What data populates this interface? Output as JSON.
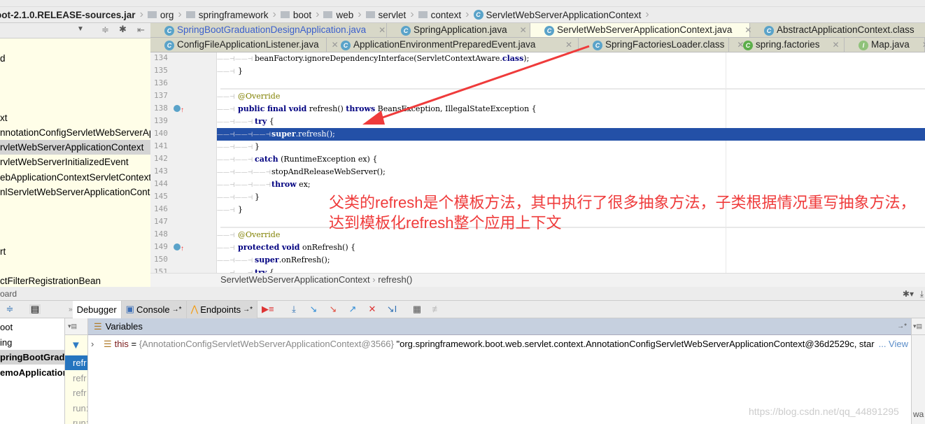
{
  "breadcrumb": [
    "oot-2.1.0.RELEASE-sources.jar",
    "org",
    "springframework",
    "boot",
    "web",
    "servlet",
    "context",
    "ServletWebServerApplicationContext"
  ],
  "project_tree": {
    "items": [
      {
        "label": "d",
        "row": 0
      },
      {
        "label": "xt",
        "row": 4
      },
      {
        "label": "nnotationConfigServletWebServerAppl",
        "row": 5
      },
      {
        "label": "rvletWebServerApplicationContext",
        "row": 6,
        "selected": true
      },
      {
        "label": "rvletWebServerInitializedEvent",
        "row": 7
      },
      {
        "label": "ebApplicationContextServletContextA",
        "row": 8
      },
      {
        "label": "nlServletWebServerApplicationContex",
        "row": 9
      },
      {
        "label": "rt",
        "row": 13
      },
      {
        "label": "ctFilterRegistrationBean",
        "row": 15
      }
    ]
  },
  "tabs_row1": [
    {
      "label": "SpringBootGraduationDesignApplication.java",
      "color": "#3b5fcc"
    },
    {
      "label": "SpringApplication.java"
    },
    {
      "label": "ServletWebServerApplicationContext.java",
      "active": true
    },
    {
      "label": "AbstractApplicationContext.class"
    }
  ],
  "tabs_row2": [
    {
      "label": "ConfigFileApplicationListener.java"
    },
    {
      "label": "ApplicationEnvironmentPreparedEvent.java"
    },
    {
      "label": "SpringFactoriesLoader.class"
    },
    {
      "label": "spring.factories"
    },
    {
      "label": "Map.java"
    }
  ],
  "code": [
    {
      "n": "134",
      "indent": 2,
      "tokens": [
        [
          "beanFactory.ignoreDependencyInterface(ServletContextAware.",
          ""
        ],
        [
          "class",
          "kw"
        ],
        [
          ");",
          ""
        ]
      ]
    },
    {
      "n": "135",
      "indent": 1,
      "tokens": [
        [
          "}",
          ""
        ]
      ]
    },
    {
      "n": "136",
      "indent": 0,
      "tokens": []
    },
    {
      "n": "137",
      "indent": 1,
      "tokens": [
        [
          "@Override",
          "ann"
        ]
      ]
    },
    {
      "n": "138",
      "indent": 1,
      "override": true,
      "tokens": [
        [
          "public",
          "kw"
        ],
        [
          " ",
          ""
        ],
        [
          "final",
          "kw"
        ],
        [
          " ",
          ""
        ],
        [
          "void",
          "kw"
        ],
        [
          " refresh() ",
          ""
        ],
        [
          "throws",
          "kw"
        ],
        [
          " BeansException, IllegalStateException {",
          ""
        ]
      ]
    },
    {
      "n": "139",
      "indent": 2,
      "tokens": [
        [
          "try",
          "kw"
        ],
        [
          " {",
          ""
        ]
      ]
    },
    {
      "n": "140",
      "indent": 3,
      "current": true,
      "tokens": [
        [
          "super",
          "kw"
        ],
        [
          ".refresh();",
          ""
        ]
      ]
    },
    {
      "n": "141",
      "indent": 2,
      "tokens": [
        [
          "}",
          ""
        ]
      ]
    },
    {
      "n": "142",
      "indent": 2,
      "tokens": [
        [
          "catch",
          "kw"
        ],
        [
          " (RuntimeException ex) {",
          ""
        ]
      ]
    },
    {
      "n": "143",
      "indent": 3,
      "tokens": [
        [
          "stopAndReleaseWebServer();",
          ""
        ]
      ]
    },
    {
      "n": "144",
      "indent": 3,
      "tokens": [
        [
          "throw",
          "kw"
        ],
        [
          " ex;",
          ""
        ]
      ]
    },
    {
      "n": "145",
      "indent": 2,
      "tokens": [
        [
          "}",
          ""
        ]
      ]
    },
    {
      "n": "146",
      "indent": 1,
      "tokens": [
        [
          "}",
          ""
        ]
      ]
    },
    {
      "n": "147",
      "indent": 0,
      "tokens": []
    },
    {
      "n": "148",
      "indent": 1,
      "tokens": [
        [
          "@Override",
          "ann"
        ]
      ]
    },
    {
      "n": "149",
      "indent": 1,
      "override": true,
      "tokens": [
        [
          "protected",
          "kw"
        ],
        [
          " ",
          ""
        ],
        [
          "void",
          "kw"
        ],
        [
          " onRefresh() {",
          ""
        ]
      ]
    },
    {
      "n": "150",
      "indent": 2,
      "tokens": [
        [
          "super",
          "kw"
        ],
        [
          ".onRefresh();",
          ""
        ]
      ]
    },
    {
      "n": "151",
      "indent": 2,
      "tokens": [
        [
          "try",
          "kw"
        ],
        [
          " {",
          ""
        ]
      ]
    }
  ],
  "annotation_note": "父类的refresh是个模板方法，其中执行了很多抽象方法，子类根据情况重写抽象方法，达到模板化refresh整个应用上下文",
  "editor_breadcrumb": {
    "cls": "ServletWebServerApplicationContext",
    "method": "refresh()"
  },
  "debug": {
    "header": "oard",
    "tabs": {
      "debugger": "Debugger",
      "console": "Console",
      "endpoints": "Endpoints"
    },
    "threads": [
      "oot",
      "ing",
      "pringBootGradu",
      "emoApplication"
    ],
    "frames": [
      "refr",
      "refr",
      "refr",
      "run:",
      "run:"
    ],
    "variables_title": "Variables",
    "var": {
      "name": "this",
      "eq": " = ",
      "type": "{AnnotationConfigServletWebServerApplicationContext@3566}",
      "value": " \"org.springframework.boot.web.servlet.context.AnnotationConfigServletWebServerApplicationContext@36d2529c, star",
      "view": "... View"
    },
    "watch": "wa"
  },
  "watermark": "https://blog.csdn.net/qq_44891295",
  "colors": {
    "selection": "#2350a7",
    "note": "#ef3b3b",
    "frame_selected": "#2675bf",
    "vars_header": "#c6d0df"
  }
}
